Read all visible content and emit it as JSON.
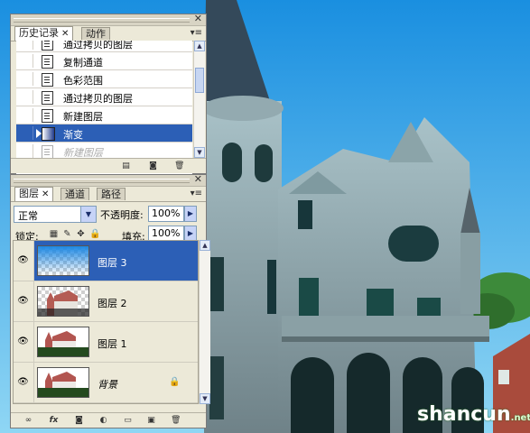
{
  "history_panel": {
    "tabs": [
      {
        "label": "历史记录",
        "active": true
      },
      {
        "label": "动作",
        "active": false
      }
    ],
    "items": [
      {
        "label": "通过拷贝的图层",
        "state": "normal"
      },
      {
        "label": "复制通道",
        "state": "normal"
      },
      {
        "label": "色彩范围",
        "state": "normal"
      },
      {
        "label": "通过拷贝的图层",
        "state": "normal"
      },
      {
        "label": "新建图层",
        "state": "normal"
      },
      {
        "label": "渐变",
        "state": "selected"
      },
      {
        "label": "新建图层",
        "state": "undone"
      }
    ],
    "bottom_icons": [
      "new-document-from-state-icon",
      "snapshot-camera-icon",
      "trash-icon"
    ]
  },
  "layers_panel": {
    "tabs": [
      {
        "label": "图层",
        "active": true
      },
      {
        "label": "通道",
        "active": false
      },
      {
        "label": "路径",
        "active": false
      }
    ],
    "blend_mode": "正常",
    "opacity_label": "不透明度:",
    "opacity_value": "100%",
    "lock_label": "锁定:",
    "fill_label": "填充:",
    "fill_value": "100%",
    "lock_icons": [
      "lock-transparency-icon",
      "lock-brush-icon",
      "lock-move-icon",
      "lock-all-icon"
    ],
    "layers": [
      {
        "name": "图层 3",
        "selected": true,
        "visible": true,
        "thumb": "gradient"
      },
      {
        "name": "图层 2",
        "selected": false,
        "visible": true,
        "thumb": "cutout"
      },
      {
        "name": "图层 1",
        "selected": false,
        "visible": true,
        "thumb": "photo"
      },
      {
        "name": "背景",
        "selected": false,
        "visible": true,
        "thumb": "photo",
        "locked": true
      }
    ],
    "bottom_icons": [
      "link-layers-icon",
      "layer-style-fx-icon",
      "layer-mask-icon",
      "adjustment-layer-icon",
      "new-group-folder-icon",
      "new-layer-icon",
      "delete-layer-icon"
    ]
  },
  "watermark": {
    "text": "shancun",
    "suffix": ".net"
  }
}
